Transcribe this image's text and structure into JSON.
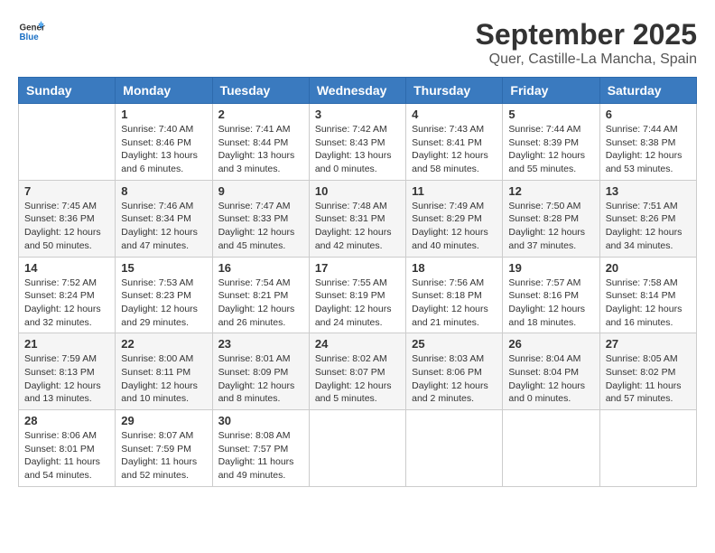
{
  "header": {
    "logo_line1": "General",
    "logo_line2": "Blue",
    "title": "September 2025",
    "subtitle": "Quer, Castille-La Mancha, Spain"
  },
  "weekdays": [
    "Sunday",
    "Monday",
    "Tuesday",
    "Wednesday",
    "Thursday",
    "Friday",
    "Saturday"
  ],
  "weeks": [
    [
      {
        "day": "",
        "info": ""
      },
      {
        "day": "1",
        "info": "Sunrise: 7:40 AM\nSunset: 8:46 PM\nDaylight: 13 hours\nand 6 minutes."
      },
      {
        "day": "2",
        "info": "Sunrise: 7:41 AM\nSunset: 8:44 PM\nDaylight: 13 hours\nand 3 minutes."
      },
      {
        "day": "3",
        "info": "Sunrise: 7:42 AM\nSunset: 8:43 PM\nDaylight: 13 hours\nand 0 minutes."
      },
      {
        "day": "4",
        "info": "Sunrise: 7:43 AM\nSunset: 8:41 PM\nDaylight: 12 hours\nand 58 minutes."
      },
      {
        "day": "5",
        "info": "Sunrise: 7:44 AM\nSunset: 8:39 PM\nDaylight: 12 hours\nand 55 minutes."
      },
      {
        "day": "6",
        "info": "Sunrise: 7:44 AM\nSunset: 8:38 PM\nDaylight: 12 hours\nand 53 minutes."
      }
    ],
    [
      {
        "day": "7",
        "info": "Sunrise: 7:45 AM\nSunset: 8:36 PM\nDaylight: 12 hours\nand 50 minutes."
      },
      {
        "day": "8",
        "info": "Sunrise: 7:46 AM\nSunset: 8:34 PM\nDaylight: 12 hours\nand 47 minutes."
      },
      {
        "day": "9",
        "info": "Sunrise: 7:47 AM\nSunset: 8:33 PM\nDaylight: 12 hours\nand 45 minutes."
      },
      {
        "day": "10",
        "info": "Sunrise: 7:48 AM\nSunset: 8:31 PM\nDaylight: 12 hours\nand 42 minutes."
      },
      {
        "day": "11",
        "info": "Sunrise: 7:49 AM\nSunset: 8:29 PM\nDaylight: 12 hours\nand 40 minutes."
      },
      {
        "day": "12",
        "info": "Sunrise: 7:50 AM\nSunset: 8:28 PM\nDaylight: 12 hours\nand 37 minutes."
      },
      {
        "day": "13",
        "info": "Sunrise: 7:51 AM\nSunset: 8:26 PM\nDaylight: 12 hours\nand 34 minutes."
      }
    ],
    [
      {
        "day": "14",
        "info": "Sunrise: 7:52 AM\nSunset: 8:24 PM\nDaylight: 12 hours\nand 32 minutes."
      },
      {
        "day": "15",
        "info": "Sunrise: 7:53 AM\nSunset: 8:23 PM\nDaylight: 12 hours\nand 29 minutes."
      },
      {
        "day": "16",
        "info": "Sunrise: 7:54 AM\nSunset: 8:21 PM\nDaylight: 12 hours\nand 26 minutes."
      },
      {
        "day": "17",
        "info": "Sunrise: 7:55 AM\nSunset: 8:19 PM\nDaylight: 12 hours\nand 24 minutes."
      },
      {
        "day": "18",
        "info": "Sunrise: 7:56 AM\nSunset: 8:18 PM\nDaylight: 12 hours\nand 21 minutes."
      },
      {
        "day": "19",
        "info": "Sunrise: 7:57 AM\nSunset: 8:16 PM\nDaylight: 12 hours\nand 18 minutes."
      },
      {
        "day": "20",
        "info": "Sunrise: 7:58 AM\nSunset: 8:14 PM\nDaylight: 12 hours\nand 16 minutes."
      }
    ],
    [
      {
        "day": "21",
        "info": "Sunrise: 7:59 AM\nSunset: 8:13 PM\nDaylight: 12 hours\nand 13 minutes."
      },
      {
        "day": "22",
        "info": "Sunrise: 8:00 AM\nSunset: 8:11 PM\nDaylight: 12 hours\nand 10 minutes."
      },
      {
        "day": "23",
        "info": "Sunrise: 8:01 AM\nSunset: 8:09 PM\nDaylight: 12 hours\nand 8 minutes."
      },
      {
        "day": "24",
        "info": "Sunrise: 8:02 AM\nSunset: 8:07 PM\nDaylight: 12 hours\nand 5 minutes."
      },
      {
        "day": "25",
        "info": "Sunrise: 8:03 AM\nSunset: 8:06 PM\nDaylight: 12 hours\nand 2 minutes."
      },
      {
        "day": "26",
        "info": "Sunrise: 8:04 AM\nSunset: 8:04 PM\nDaylight: 12 hours\nand 0 minutes."
      },
      {
        "day": "27",
        "info": "Sunrise: 8:05 AM\nSunset: 8:02 PM\nDaylight: 11 hours\nand 57 minutes."
      }
    ],
    [
      {
        "day": "28",
        "info": "Sunrise: 8:06 AM\nSunset: 8:01 PM\nDaylight: 11 hours\nand 54 minutes."
      },
      {
        "day": "29",
        "info": "Sunrise: 8:07 AM\nSunset: 7:59 PM\nDaylight: 11 hours\nand 52 minutes."
      },
      {
        "day": "30",
        "info": "Sunrise: 8:08 AM\nSunset: 7:57 PM\nDaylight: 11 hours\nand 49 minutes."
      },
      {
        "day": "",
        "info": ""
      },
      {
        "day": "",
        "info": ""
      },
      {
        "day": "",
        "info": ""
      },
      {
        "day": "",
        "info": ""
      }
    ]
  ]
}
